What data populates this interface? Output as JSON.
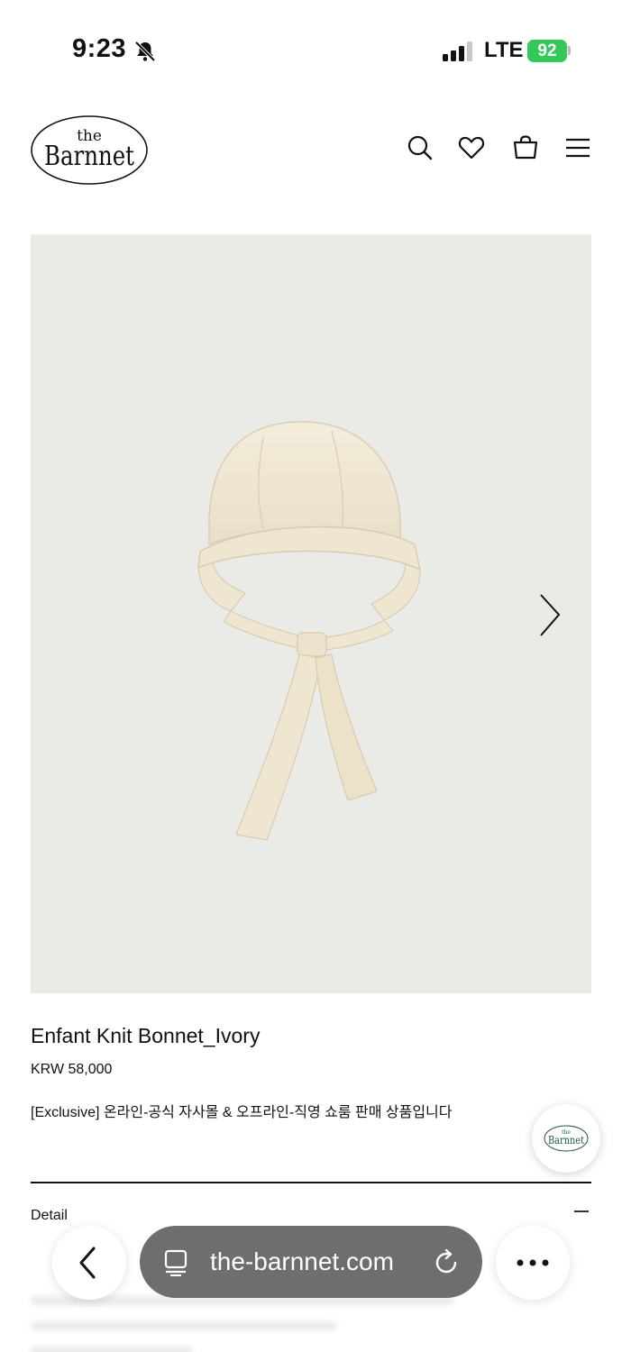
{
  "status_bar": {
    "time": "9:23",
    "network": "LTE",
    "battery": "92"
  },
  "header": {
    "logo_small": "the",
    "logo_main": "Barnnet",
    "icons": [
      "search-icon",
      "heart-icon",
      "bag-icon",
      "menu-icon"
    ]
  },
  "product": {
    "title": "Enfant Knit Bonnet_Ivory",
    "price": "KRW 58,000",
    "note": "[Exclusive] 온라인-공식 자사몰 & 오프라인-직영 쇼룸 판매 상품입니다",
    "detail_label": "Detail",
    "detail_toggle": "–"
  },
  "browser": {
    "url": "the-barnnet.com"
  },
  "colors": {
    "image_bg": "#eaeae6",
    "bonnet": "#f2ead8",
    "battery": "#34c759",
    "badge_logo": "#1f5b3a",
    "url_pill": "#6e6e6e"
  }
}
